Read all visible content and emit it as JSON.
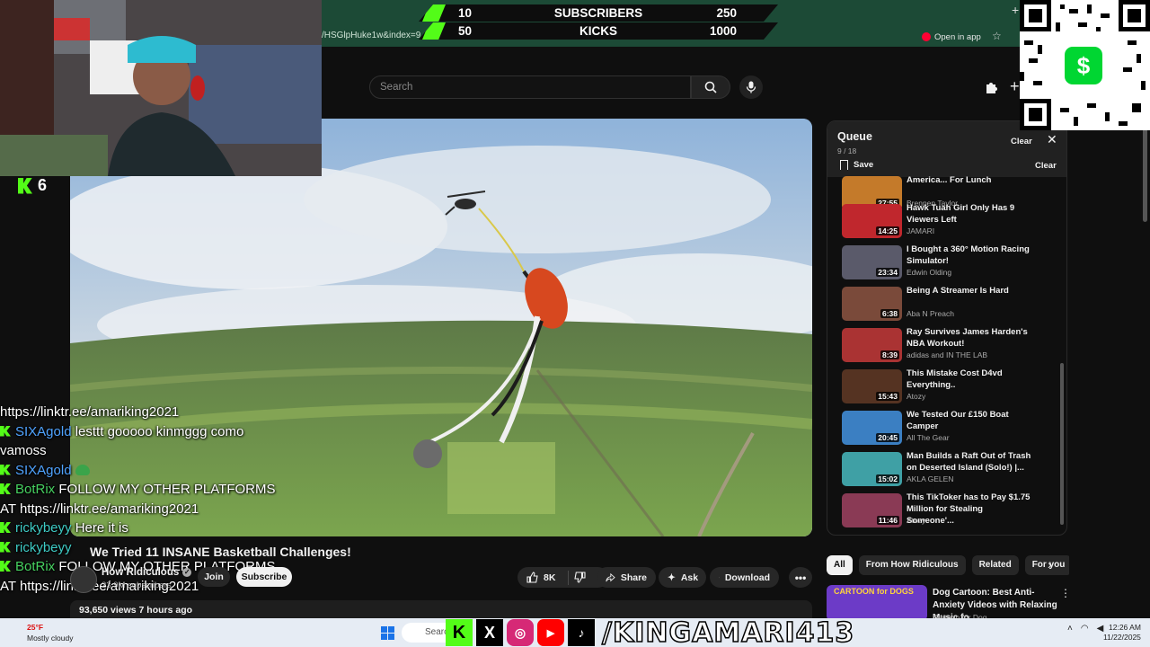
{
  "browser": {
    "url_fragment": "/HSGlpHuke1w&index=9",
    "open_app_label": "Open in app"
  },
  "goal": {
    "row1": {
      "current": "10",
      "label": "SUBSCRIBERS",
      "target": "250"
    },
    "row2": {
      "current": "50",
      "label": "KICKS",
      "target": "1000"
    },
    "accent_color": "#53fc18"
  },
  "youtube": {
    "search_placeholder": "Search",
    "video_title": "We Tried 11 INSANE Basketball Challenges!",
    "channel_name": "How Ridiculous",
    "subscribers": "23.9M subscribers",
    "join_label": "Join",
    "subscribe_label": "Subscribe",
    "likes": "8K",
    "share_label": "Share",
    "ask_label": "Ask",
    "download_label": "Download",
    "views_line": "93,650 views  7 hours ago"
  },
  "stream": {
    "viewer_count": "6",
    "chat": [
      {
        "user": "",
        "text": "https://linktr.ee/amariking2021",
        "color": "#ffffff",
        "badge": false
      },
      {
        "user": "SIXAgold",
        "text": "lesttt gooooo kinmggg como vamoss",
        "color": "#4fa3ff",
        "badge": true
      },
      {
        "user": "SIXAgold",
        "text": "",
        "color": "#4fa3ff",
        "badge": true,
        "emote": "frog-emote"
      },
      {
        "user": "BotRix",
        "text": "FOLLOW MY OTHER PLATFORMS AT https://linktr.ee/amariking2021",
        "color": "#46d160",
        "badge": true
      },
      {
        "user": "rickybeyy",
        "text": "Here it is",
        "color": "#3ecbc5",
        "badge": true
      },
      {
        "user": "rickybeyy",
        "text": "",
        "color": "#3ecbc5",
        "badge": true
      },
      {
        "user": "BotRix",
        "text": "FOLLOW MY OTHER PLATFORMS AT https://linktr.ee/amariking2021",
        "color": "#46d160",
        "badge": true
      }
    ],
    "handle": "/KINGAMARI413"
  },
  "queue": {
    "title": "Queue",
    "count": "9 / 18",
    "clear_label": "Clear",
    "save_label": "Save",
    "items": [
      {
        "title": "America... For Lunch",
        "channel": "Brennen Taylor",
        "duration": "27:55",
        "thumb_color": "#c47a2a"
      },
      {
        "title": "Hawk Tuah Girl Only Has 9 Viewers Left",
        "channel": "JAMARI",
        "duration": "14:25",
        "thumb_color": "#c0272d"
      },
      {
        "title": "I Bought a 360° Motion Racing Simulator!",
        "channel": "Edwin Olding",
        "duration": "23:34",
        "thumb_color": "#5a5a6a"
      },
      {
        "title": "Being A Streamer Is Hard",
        "channel": "Aba N Preach",
        "duration": "6:38",
        "thumb_color": "#7a4a3a"
      },
      {
        "title": "Ray Survives James Harden's NBA Workout!",
        "channel": "adidas and IN THE LAB",
        "duration": "8:39",
        "thumb_color": "#a33"
      },
      {
        "title": "This Mistake Cost D4vd Everything..",
        "channel": "Atozy",
        "duration": "15:43",
        "thumb_color": "#553322"
      },
      {
        "title": "We Tested Our £150 Boat Camper",
        "channel": "All The Gear",
        "duration": "20:45",
        "thumb_color": "#3b7fc2"
      },
      {
        "title": "Man Builds a Raft Out of Trash on Deserted Island (Solo!) |...",
        "channel": "AKLA GELEN",
        "duration": "15:02",
        "thumb_color": "#3fa0a5"
      },
      {
        "title": "This TikToker has to Pay $1.75 Million for Stealing Someone'...",
        "channel": "Atozy",
        "duration": "11:46",
        "thumb_color": "#8a3a55"
      }
    ]
  },
  "chips": [
    "All",
    "From How Ridiculous",
    "Related",
    "For you"
  ],
  "recommendation": {
    "thumb_text": "CARTOON for DOGS",
    "title": "Dog Cartoon: Best Anti-Anxiety Videos with Relaxing Music fo...",
    "channel": "Cartoon for Dog"
  },
  "taskbar": {
    "temp": "25°F",
    "weather": "Mostly cloudy",
    "search_label": "Search",
    "time": "12:26 AM",
    "date": "11/22/2025"
  }
}
